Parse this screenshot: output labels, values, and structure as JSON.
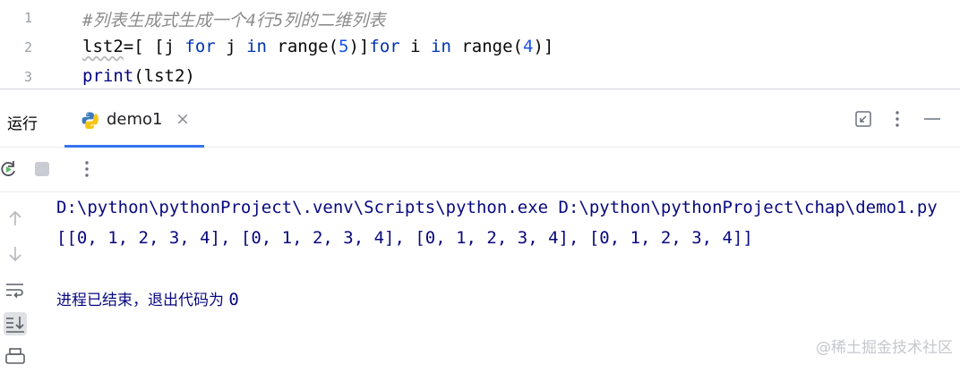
{
  "editor": {
    "lines": [
      {
        "num": "1",
        "comment": "#列表生成式生成一个4行5列的二维列表"
      },
      {
        "num": "2",
        "tokens": [
          "lst2",
          "=[ [j ",
          "for",
          " j ",
          "in",
          " range(",
          "5",
          ")]",
          "for",
          " i ",
          "in",
          " range(",
          "4",
          ")]"
        ]
      },
      {
        "num": "3",
        "tokens": [
          "print",
          "(lst2)"
        ]
      }
    ]
  },
  "run_window": {
    "title": "运行",
    "tab": {
      "label": "demo1",
      "icon": "python-icon",
      "close": "×"
    },
    "header_icons": [
      "restore-icon",
      "more-vert-icon",
      "minimize-icon"
    ],
    "toolbar_icons": [
      "rerun-icon",
      "stop-icon",
      "more-vert-icon"
    ],
    "sidebar_icons": [
      "up-arrow-icon",
      "down-arrow-icon",
      "soft-wrap-icon",
      "scroll-to-end-icon",
      "print-icon"
    ]
  },
  "console": {
    "command": "D:\\python\\pythonProject\\.venv\\Scripts\\python.exe D:\\python\\pythonProject\\chap\\demo1.py",
    "output": "[[0, 1, 2, 3, 4], [0, 1, 2, 3, 4], [0, 1, 2, 3, 4], [0, 1, 2, 3, 4]]",
    "exit_text": "进程已结束，退出代码为 ",
    "exit_code": "0"
  },
  "watermark": "@稀土掘金技术社区",
  "colors": {
    "accent": "#3574f0",
    "keyword": "#0033b3",
    "number": "#1750eb",
    "console_text": "#080880"
  }
}
